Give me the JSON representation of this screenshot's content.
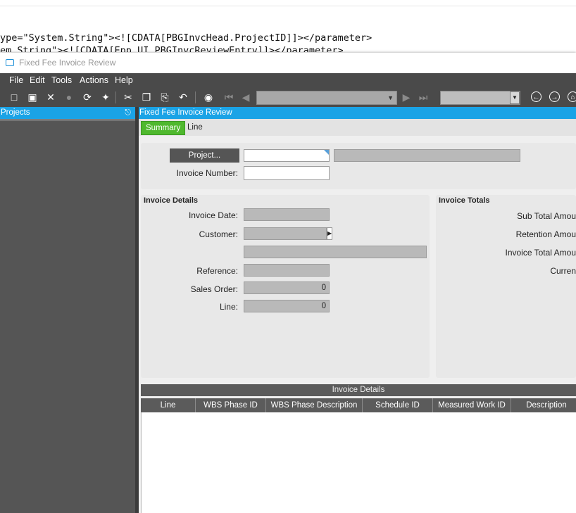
{
  "background_code": {
    "line1": "ype=\"System.String\"><![CDATA[PBGInvcHead.ProjectID]]></parameter>",
    "line2": "em.String\"><![CDATA[Epp.UI.PBGInvcReviewEntry]]></parameter>"
  },
  "window": {
    "title": "Fixed Fee Invoice Review"
  },
  "menu": {
    "items": [
      "File",
      "Edit",
      "Tools",
      "Actions",
      "Help"
    ]
  },
  "toolbar": {
    "icons": [
      "new-icon",
      "save-icon",
      "delete-icon",
      "chat-icon",
      "refresh-icon",
      "clear-icon",
      "cut-icon",
      "copy-icon",
      "paste-icon",
      "undo-icon",
      "binoculars-icon",
      "first-record-icon",
      "prev-record-icon",
      "next-record-icon",
      "last-record-icon",
      "back-icon",
      "forward-icon",
      "home-icon"
    ],
    "record_combo_value": "",
    "secondary_combo_value": ""
  },
  "left_panel": {
    "title": "Projects"
  },
  "main": {
    "title": "Fixed Fee Invoice Review",
    "tabs": [
      "Summary",
      "Line"
    ],
    "active_tab": "Summary",
    "header": {
      "project_button": "Project...",
      "project_id": "",
      "project_description": "",
      "invoice_number_label": "Invoice Number:",
      "invoice_number": ""
    },
    "invoice_details": {
      "title": "Invoice Details",
      "invoice_date_label": "Invoice Date:",
      "invoice_date": "",
      "customer_label": "Customer:",
      "customer": "",
      "customer_name": "",
      "reference_label": "Reference:",
      "reference": "",
      "sales_order_label": "Sales Order:",
      "sales_order": "0",
      "line_label": "Line:",
      "line": "0"
    },
    "invoice_totals": {
      "title": "Invoice Totals",
      "sub_total_label": "Sub Total Amou",
      "retention_label": "Retention Amou",
      "invoice_total_label": "Invoice Total Amou",
      "currency_label": "Curren"
    },
    "grid": {
      "title": "Invoice Details",
      "columns": [
        "Line",
        "WBS Phase ID",
        "WBS Phase Description",
        "Schedule ID",
        "Measured Work ID",
        "Description"
      ]
    }
  }
}
